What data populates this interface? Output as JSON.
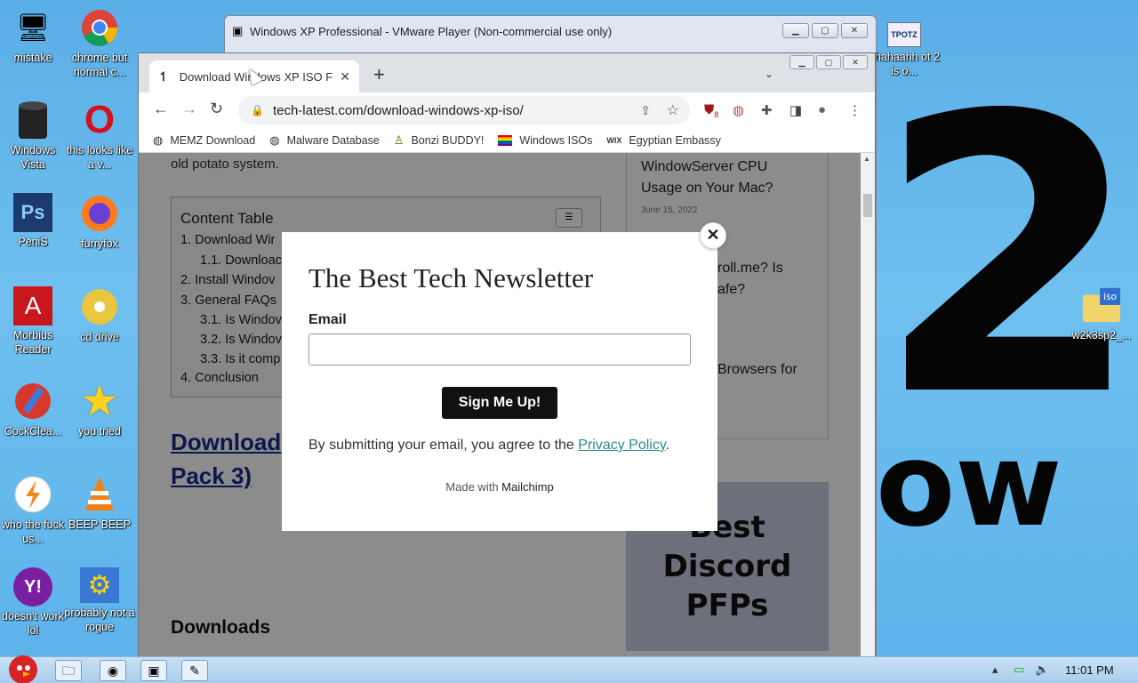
{
  "desktop": {
    "wallpaper_big": "2",
    "wallpaper_small": "ow",
    "icons": [
      {
        "label": "mistake",
        "icon": "computer-icon",
        "glyph": "🖥"
      },
      {
        "label": "chrome but normal c...",
        "icon": "chrome-icon",
        "glyph": "◉"
      },
      {
        "label": "Windows Vista",
        "icon": "recycle-bin-icon",
        "glyph": "🗑"
      },
      {
        "label": "this looks like a v...",
        "icon": "opera-icon",
        "glyph": "O"
      },
      {
        "label": "PeniS",
        "icon": "photoshop-icon",
        "glyph": "Ps"
      },
      {
        "label": "furryfox",
        "icon": "firefox-icon",
        "glyph": "🦊"
      },
      {
        "label": "Morbius Reader",
        "icon": "acrobat-icon",
        "glyph": "A"
      },
      {
        "label": "cd drive",
        "icon": "cd-drive-icon",
        "glyph": "💿"
      },
      {
        "label": "CockClea...",
        "icon": "ccleaner-icon",
        "glyph": "🧹"
      },
      {
        "label": "you tried",
        "icon": "star-icon",
        "glyph": "★"
      },
      {
        "label": "who the fuck us...",
        "icon": "winamp-icon",
        "glyph": "⚡"
      },
      {
        "label": "BEEP BEEP",
        "icon": "vlc-icon",
        "glyph": "▲"
      },
      {
        "label": "doesn't work lol",
        "icon": "yahoo-messenger-icon",
        "glyph": "Y!"
      },
      {
        "label": "probably not a rogue",
        "icon": "settings-program-icon",
        "glyph": "⚙"
      }
    ],
    "right_icons": [
      {
        "label": "ahahaahh ot 2 is o...",
        "icon": "tpotz-icon",
        "glyph": "TPOTZ"
      },
      {
        "label": "w2k3sp2_...",
        "icon": "iso-folder-icon",
        "glyph": "iso"
      }
    ]
  },
  "vmware": {
    "title": "Windows XP Professional - VMware Player (Non-commercial use only)"
  },
  "chrome": {
    "tab_title": "Download Windows XP ISO Fil",
    "tab_favicon": "↿",
    "url": "tech-latest.com/download-windows-xp-iso/",
    "extension_badge": "8",
    "bookmarks": [
      {
        "label": "MEMZ Download",
        "icon": "globe-icon",
        "glyph": "🌐"
      },
      {
        "label": "Malware Database",
        "icon": "globe-icon",
        "glyph": "🌐"
      },
      {
        "label": "Bonzi BUDDY!",
        "icon": "bonzi-icon",
        "glyph": "♙"
      },
      {
        "label": "Windows ISOs",
        "icon": "rainbow-flag-icon",
        "glyph": "🏳"
      },
      {
        "label": "Egyptian Embassy",
        "icon": "wix-icon",
        "glyph": "WIX"
      }
    ]
  },
  "page": {
    "intro_text": "old potato system.",
    "toc_title": "Content Table",
    "toc_items": [
      "1. Download Wir",
      "1.1. Downloac",
      "2. Install Windov",
      "3. General FAQs",
      "3.1. Is Windov",
      "3.2. Is Windov",
      "3.3. Is it comp",
      "4. Conclusion"
    ],
    "heading_line1": "Download",
    "heading_line2": "Pack 3)",
    "downloads_heading": "Downloads",
    "sidebar": {
      "article1_line1": "WindowServer CPU",
      "article1_line2": "Usage on Your Mac?",
      "article1_date": "June 15, 2022",
      "article2_line1": "roll.me? Is",
      "article2_line2": "afe?",
      "article3_line1": "Browsers for"
    },
    "image_text": "Best Discord PFPs"
  },
  "modal": {
    "title": "The Best Tech Newsletter",
    "email_label": "Email",
    "email_value": "",
    "button_label": "Sign Me Up!",
    "consent_text": "By submitting your email, you agree to the ",
    "privacy_link": "Privacy Policy",
    "consent_end": ".",
    "made_with": "Made with ",
    "made_with_brand": "Mailchimp",
    "close_glyph": "✕"
  },
  "taskbar": {
    "clock": "11:01 PM"
  }
}
